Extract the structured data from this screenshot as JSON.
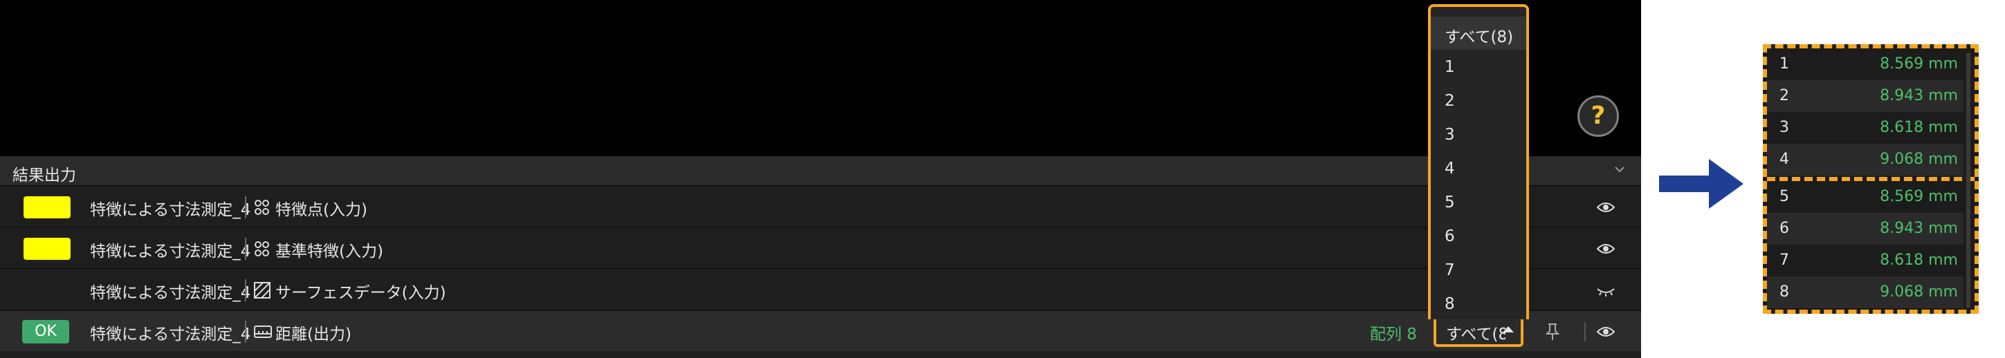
{
  "help": {
    "symbol": "?"
  },
  "panel": {
    "title": "結果出力"
  },
  "rows": [
    {
      "name": "特徴による寸法測定_4",
      "icon": "feature-points-icon",
      "label": "特徴点(入力)",
      "swatch_color": "#ffff00"
    },
    {
      "name": "特徴による寸法測定_4",
      "icon": "feature-points-icon",
      "label": "基準特徴(入力)",
      "swatch_color": "#ffff00"
    },
    {
      "name": "特徴による寸法測定_4",
      "icon": "surface-hatch-icon",
      "label": "サーフェスデータ(入力)"
    },
    {
      "name": "特徴による寸法測定_4",
      "icon": "distance-ruler-icon",
      "label": "距離(出力)",
      "badge": "OK",
      "array_label": "配列 8",
      "select_value": "すべて(8)"
    }
  ],
  "dropdown": {
    "options": [
      "すべて(8)",
      "1",
      "2",
      "3",
      "4",
      "5",
      "6",
      "7",
      "8"
    ],
    "selected": "すべて(8)"
  },
  "zoom": {
    "rows": [
      {
        "index": "1",
        "value": "8.569 mm"
      },
      {
        "index": "2",
        "value": "8.943 mm"
      },
      {
        "index": "3",
        "value": "8.618 mm"
      },
      {
        "index": "4",
        "value": "9.068 mm"
      },
      {
        "index": "5",
        "value": "8.569 mm"
      },
      {
        "index": "6",
        "value": "8.943 mm"
      },
      {
        "index": "7",
        "value": "8.618 mm"
      },
      {
        "index": "8",
        "value": "9.068 mm"
      }
    ]
  },
  "colors": {
    "highlight": "#f5a623",
    "ok": "#3fa86b",
    "value_green": "#4fbf6a",
    "arrow": "#1f3f95"
  }
}
